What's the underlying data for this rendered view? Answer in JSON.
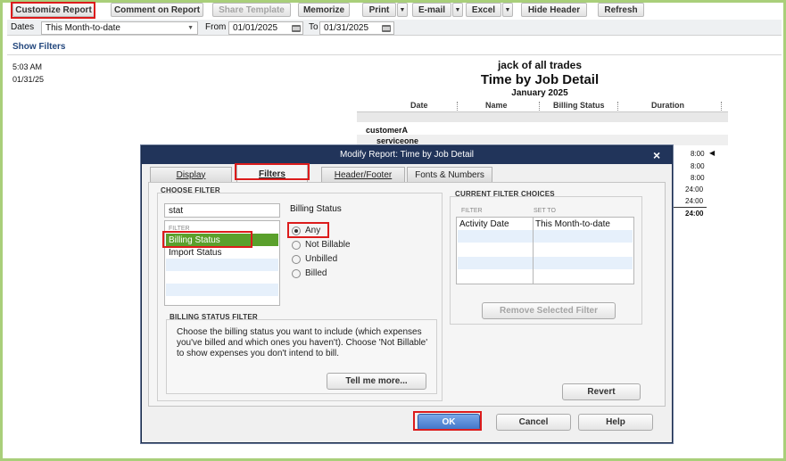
{
  "toolbar": {
    "customize_report": "Customize Report",
    "comment_on_report": "Comment on Report",
    "share_template": "Share Template",
    "memorize": "Memorize",
    "print": "Print",
    "email": "E-mail",
    "excel": "Excel",
    "hide_header": "Hide Header",
    "refresh": "Refresh",
    "dropdown_arrow": "▼"
  },
  "filter_bar": {
    "dates_label": "Dates",
    "dates_value": "This Month-to-date",
    "from_label": "From",
    "from_value": "01/01/2025",
    "to_label": "To",
    "to_value": "01/31/2025"
  },
  "show_filters": "Show Filters",
  "report": {
    "time": "5:03 AM",
    "date": "01/31/25",
    "company": "jack of all trades",
    "title": "Time by Job Detail",
    "period": "January 2025",
    "columns": [
      "Date",
      "Name",
      "Billing Status",
      "Duration"
    ],
    "customer": "customerA",
    "service": "serviceone",
    "durations": [
      "8:00",
      "8:00",
      "8:00",
      "24:00",
      "24:00",
      "24:00"
    ]
  },
  "dialog": {
    "title": "Modify Report: Time by Job Detail",
    "close": "×",
    "tabs": [
      "Display",
      "Filters",
      "Header/Footer",
      "Fonts & Numbers"
    ],
    "choose_filter": "CHOOSE FILTER",
    "search_value": "stat",
    "filter_list_header": "FILTER",
    "filter_items": [
      "Billing Status",
      "Import Status"
    ],
    "billing_status_label": "Billing Status",
    "radio_options": [
      "Any",
      "Not Billable",
      "Unbilled",
      "Billed"
    ],
    "radio_selected": "Any",
    "billing_filter_header": "BILLING STATUS FILTER",
    "billing_filter_help": "Choose the billing status you want to include (which expenses you've billed and which ones you haven't). Choose 'Not Billable' to show expenses you don't intend to bill.",
    "tell_me_more": "Tell me more...",
    "current_filter_choices": "CURRENT FILTER CHOICES",
    "current_columns": [
      "FILTER",
      "SET TO"
    ],
    "current_rows": [
      {
        "filter": "Activity Date",
        "set_to": "This Month-to-date"
      }
    ],
    "remove_selected": "Remove Selected Filter",
    "revert": "Revert",
    "ok": "OK",
    "cancel": "Cancel",
    "help": "Help"
  },
  "colors": {
    "highlight_red": "#dc1c1c",
    "selected_green": "#5aa02c",
    "dialog_titlebar": "#21345a",
    "frame_green": "#a9cf7a"
  }
}
